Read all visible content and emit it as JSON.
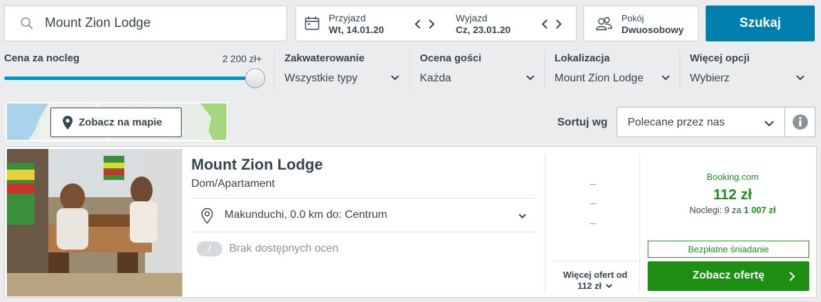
{
  "search": {
    "value": "Mount Zion Lodge"
  },
  "dates": {
    "checkin_label": "Przyjazd",
    "checkin_value": "Wt, 14.01.20",
    "checkout_label": "Wyjazd",
    "checkout_value": "Cz, 23.01.20"
  },
  "room": {
    "label": "Pokój",
    "value": "Dwuosobowy"
  },
  "search_button": "Szukaj",
  "filters": {
    "price": {
      "title": "Cena za nocleg",
      "max": "2 200 zł+",
      "level": 1.0
    },
    "accommodation": {
      "title": "Zakwaterowanie",
      "value": "Wszystkie typy"
    },
    "rating": {
      "title": "Ocena gości",
      "value": "Każda"
    },
    "location": {
      "title": "Lokalizacja",
      "value": "Mount Zion Lodge"
    },
    "more": {
      "title": "Więcej opcji",
      "value": "Wybierz"
    }
  },
  "map_button": "Zobacz na mapie",
  "sort": {
    "label": "Sortuj wg",
    "value": "Polecane przez nas"
  },
  "result": {
    "name": "Mount Zion Lodge",
    "type": "Dom/Apartament",
    "location": "Makunduchi, 0.0 km do: Centrum",
    "rating_badge": "/",
    "rating_text": "Brak dostępnych ocen",
    "dashes": [
      "–",
      "–",
      "–"
    ],
    "more_offers_label": "Więcej ofert od",
    "more_offers_price": "112 zł",
    "provider": "Booking.com",
    "price": "112 zł",
    "nights_prefix": "Noclegi: 9 za",
    "nights_total": "1 007 zł",
    "breakfast": "Bezpłatne śniadanie",
    "offer_button": "Zobacz ofertę"
  },
  "colors": {
    "accent_blue": "#007fad",
    "offer_green": "#1e8f14",
    "price_green": "#228b22"
  }
}
